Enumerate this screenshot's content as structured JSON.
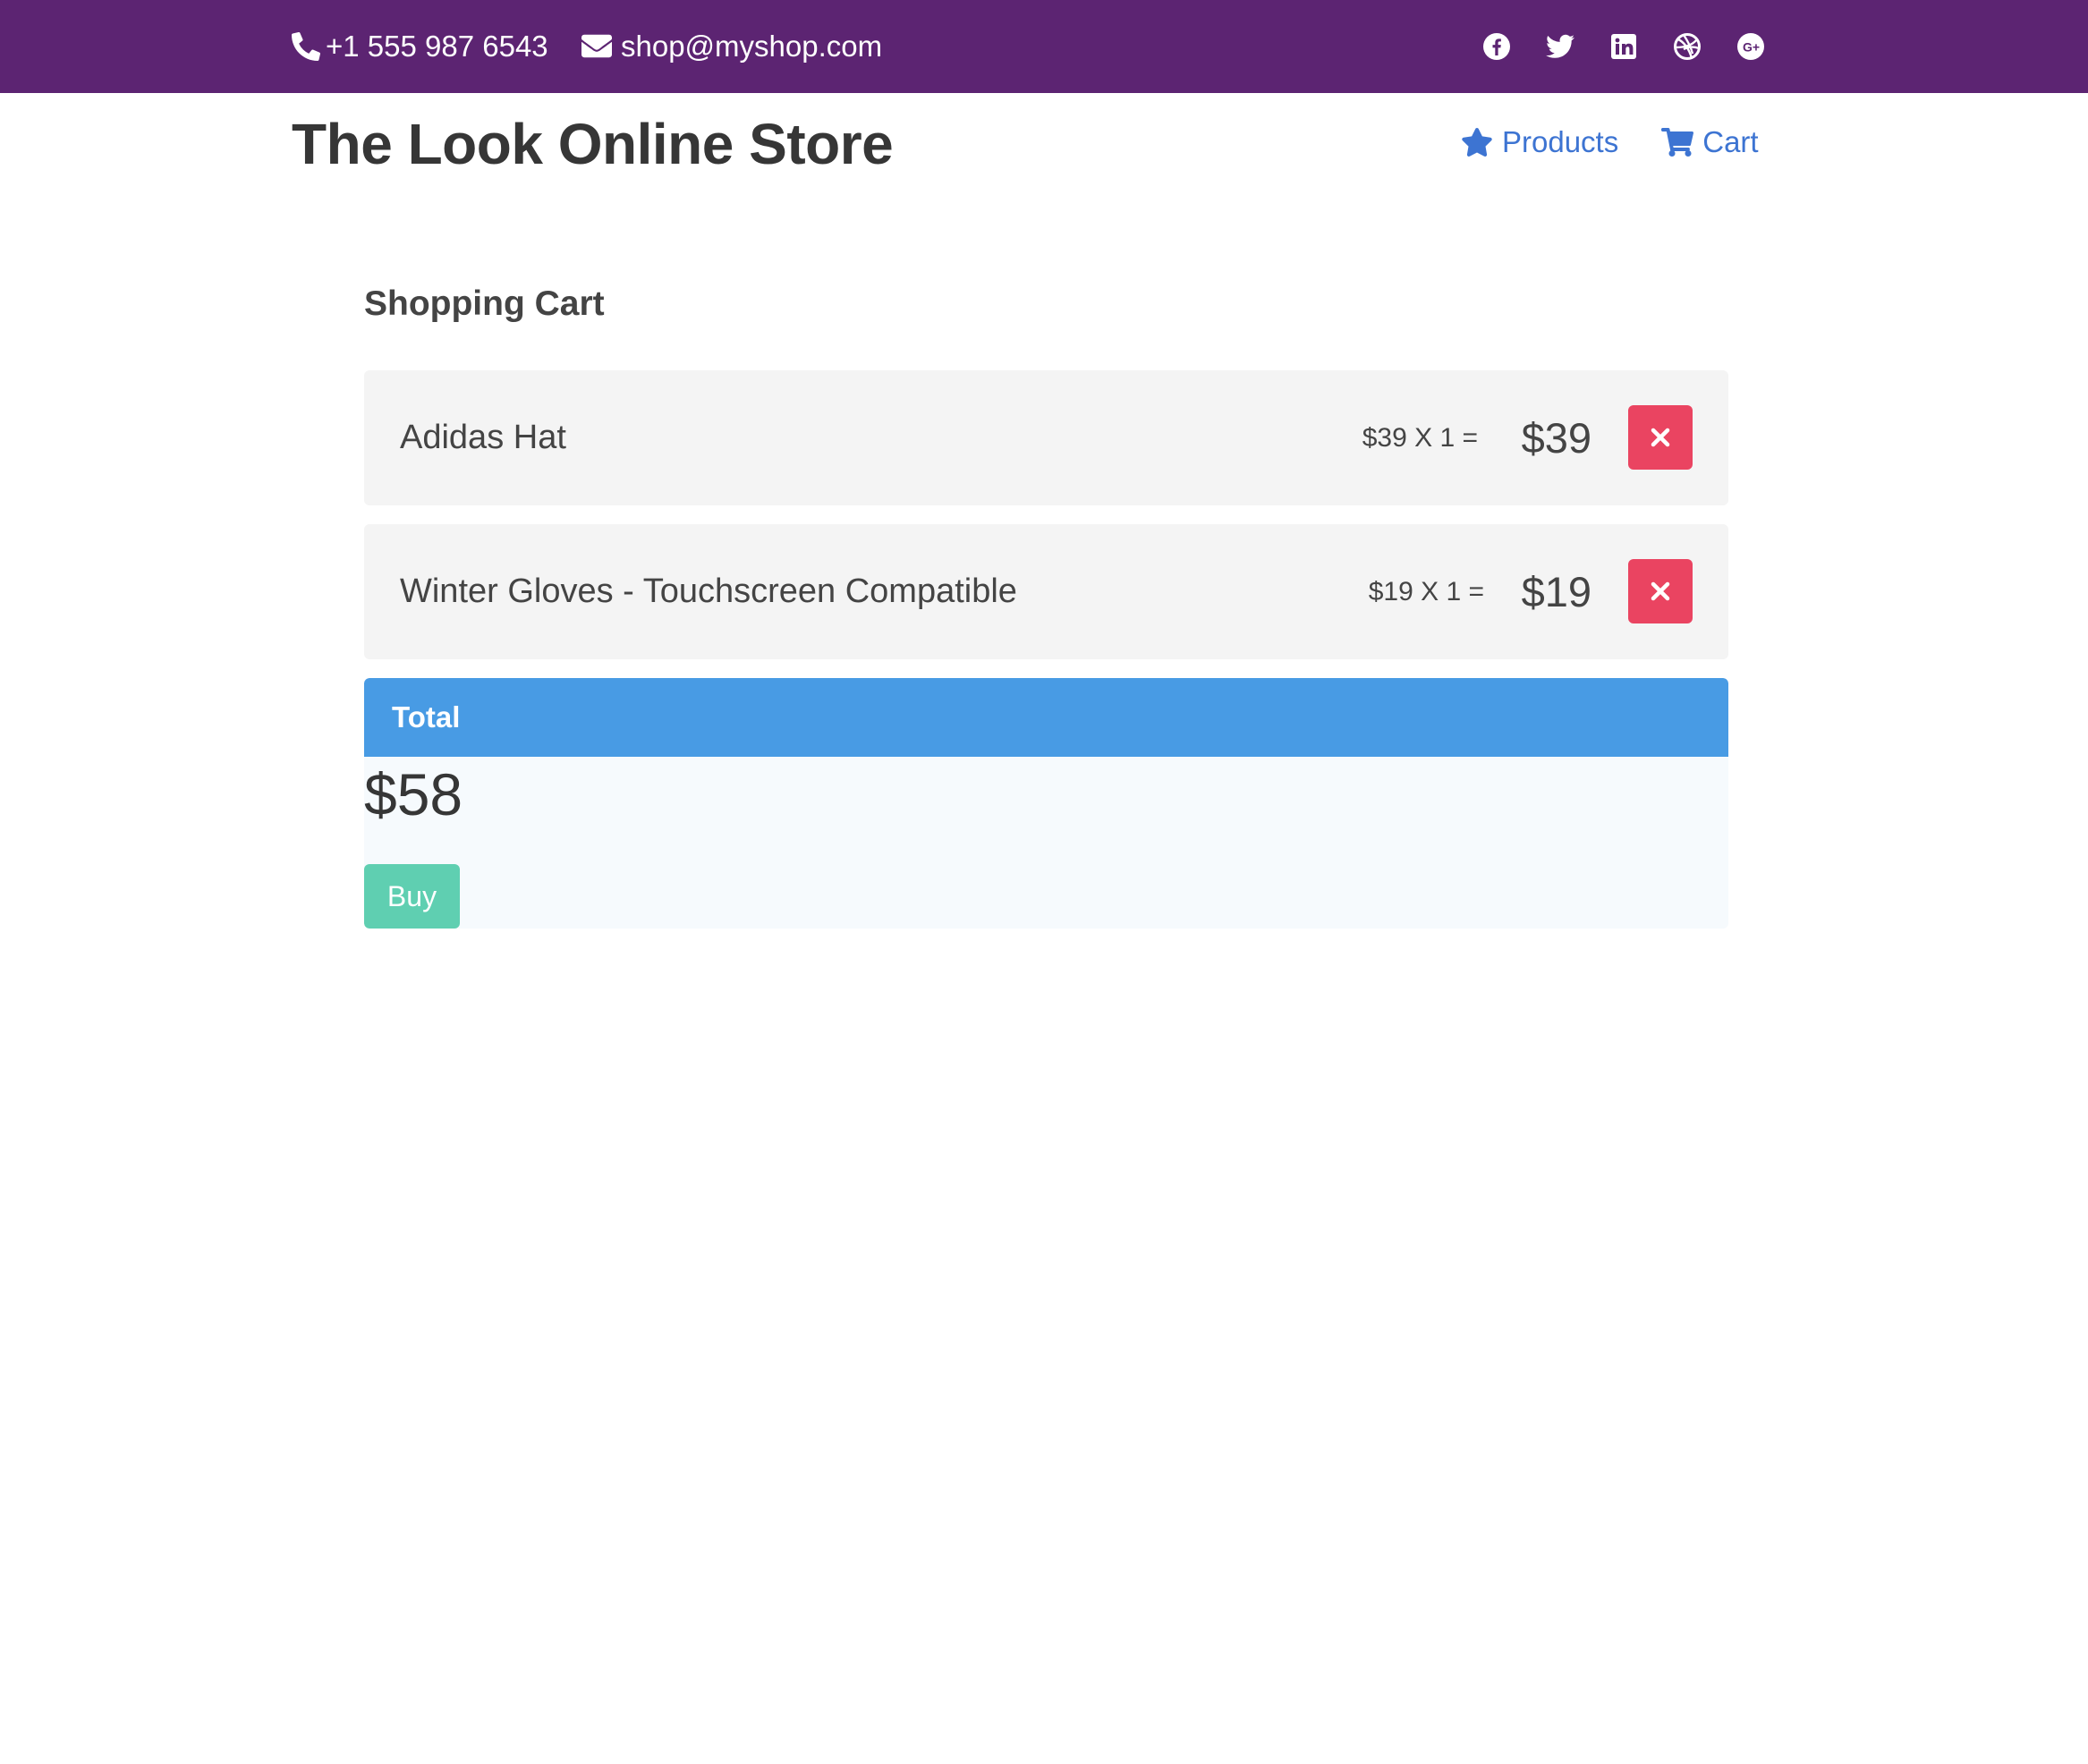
{
  "topbar": {
    "phone": "+1 555 987 6543",
    "email": "shop@myshop.com",
    "background": "#5c2472",
    "social_icons": [
      "facebook-icon",
      "twitter-icon",
      "linkedin-icon",
      "dribbble-icon",
      "google-plus-icon"
    ]
  },
  "header": {
    "brand": "The Look Online Store",
    "nav": [
      {
        "label": "Products",
        "icon": "star-icon"
      },
      {
        "label": "Cart",
        "icon": "cart-icon"
      }
    ],
    "link_color": "#3d74d2"
  },
  "cart": {
    "title": "Shopping Cart",
    "items": [
      {
        "name": "Adidas Hat",
        "calc": "$39 X 1 =",
        "subtotal": "$39",
        "remove_icon": "close-icon"
      },
      {
        "name": "Winter Gloves - Touchscreen Compatible",
        "calc": "$19 X 1 =",
        "subtotal": "$19",
        "remove_icon": "close-icon"
      }
    ],
    "remove_color": "#ea4461"
  },
  "total": {
    "label": "Total",
    "amount": "$58",
    "buy_label": "Buy",
    "header_color": "#489be4",
    "buy_color": "#5fcfb1"
  }
}
